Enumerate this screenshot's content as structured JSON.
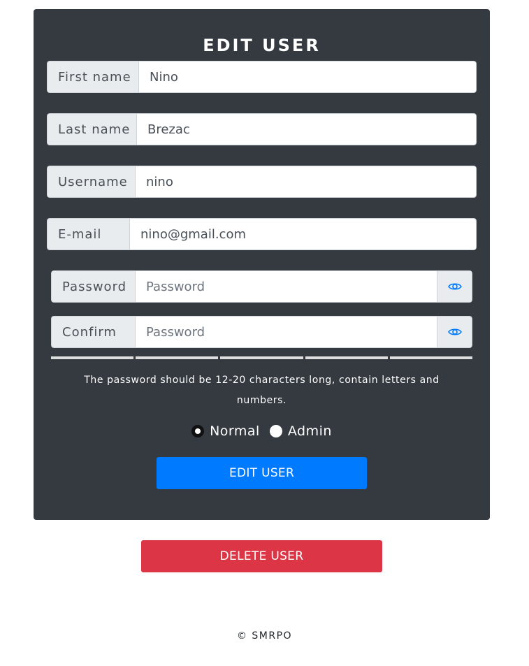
{
  "form": {
    "title": "EDIT USER",
    "first_name": {
      "label": "First name",
      "value": "Nino"
    },
    "last_name": {
      "label": "Last name",
      "value": "Brezac"
    },
    "username": {
      "label": "Username",
      "value": "nino"
    },
    "email": {
      "label": "E-mail",
      "value": "nino@gmail.com"
    },
    "password": {
      "label": "Password",
      "placeholder": "Password",
      "toggle_icon": "eye-icon"
    },
    "confirm": {
      "label": "Confirm",
      "placeholder": "Password",
      "toggle_icon": "eye-icon"
    },
    "strength_meter": {
      "filled_segments": 0,
      "total_segments": 5
    },
    "hint": "The password should be 12-20 characters long, contain letters and numbers.",
    "roles": [
      {
        "label": "Normal",
        "checked": true
      },
      {
        "label": "Admin",
        "checked": false
      }
    ],
    "submit_label": "EDIT USER"
  },
  "delete_label": "DELETE USER",
  "footer": "© SMRPO",
  "colors": {
    "card_bg": "#343a40",
    "primary": "#007bff",
    "danger": "#dc3545",
    "icon": "#007bff"
  }
}
